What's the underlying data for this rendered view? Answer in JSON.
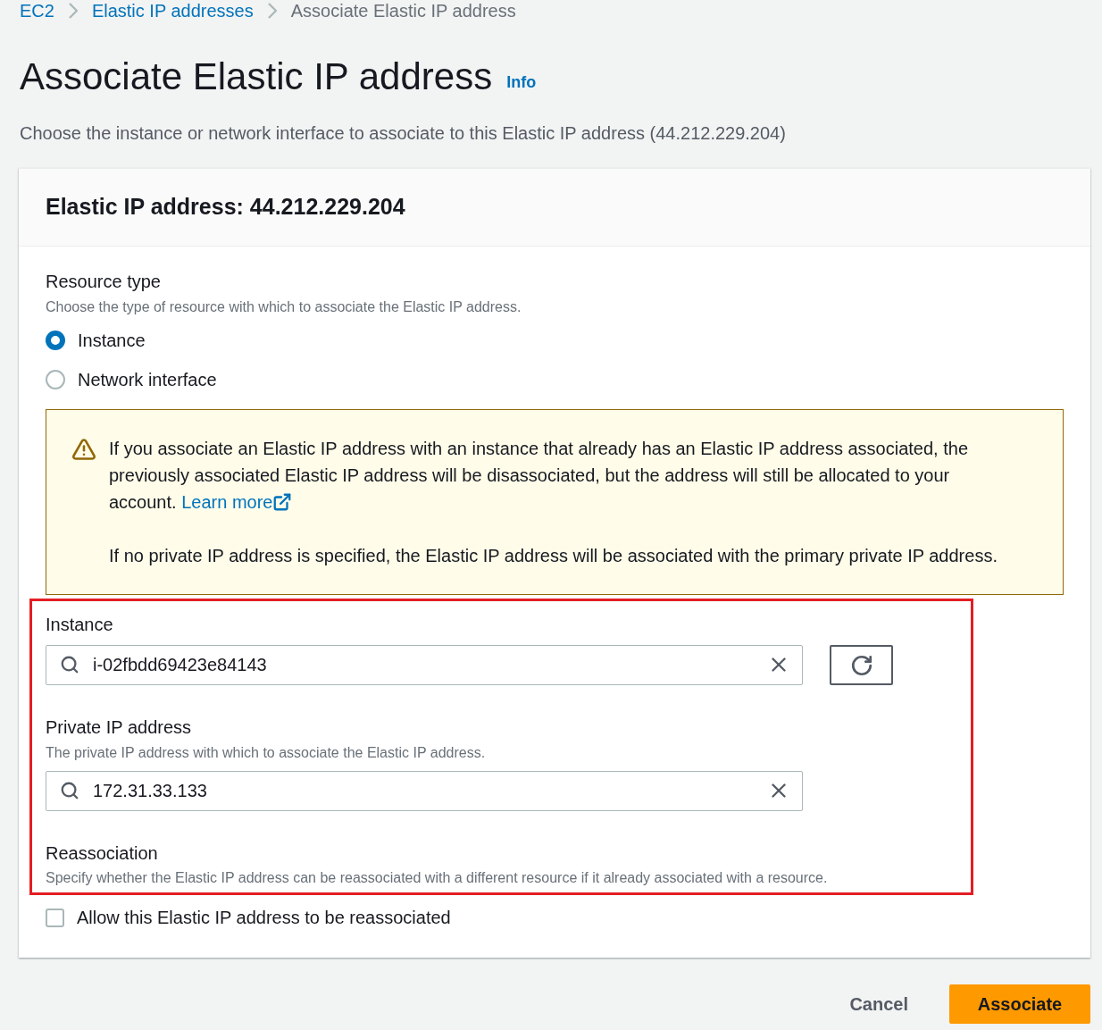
{
  "breadcrumbs": [
    {
      "label": "EC2",
      "kind": "link"
    },
    {
      "label": "Elastic IP addresses",
      "kind": "link"
    },
    {
      "label": "Associate Elastic IP address",
      "kind": "current"
    }
  ],
  "page": {
    "title": "Associate Elastic IP address",
    "info": "Info",
    "description": "Choose the instance or network interface to associate to this Elastic IP address (44.212.229.204)"
  },
  "panel": {
    "title": "Elastic IP address: 44.212.229.204"
  },
  "resource_type": {
    "label": "Resource type",
    "description": "Choose the type of resource with which to associate the Elastic IP address.",
    "options": [
      {
        "label": "Instance",
        "selected": true
      },
      {
        "label": "Network interface",
        "selected": false
      }
    ]
  },
  "warning": {
    "text": "If you associate an Elastic IP address with an instance that already has an Elastic IP address associated, the previously associated Elastic IP address will be disassociated, but the address will still be allocated to your account.",
    "link": "Learn more",
    "note": "If no private IP address is specified, the Elastic IP address will be associated with the primary private IP address."
  },
  "instance": {
    "label": "Instance",
    "value": "i-02fbdd69423e84143"
  },
  "private_ip": {
    "label": "Private IP address",
    "description": "The private IP address with which to associate the Elastic IP address.",
    "value": "172.31.33.133"
  },
  "reassociation": {
    "label": "Reassociation",
    "description": "Specify whether the Elastic IP address can be reassociated with a different resource if it already associated with a resource.",
    "checkbox": {
      "label": "Allow this Elastic IP address to be reassociated",
      "checked": false
    }
  },
  "actions": {
    "cancel": "Cancel",
    "submit": "Associate"
  }
}
